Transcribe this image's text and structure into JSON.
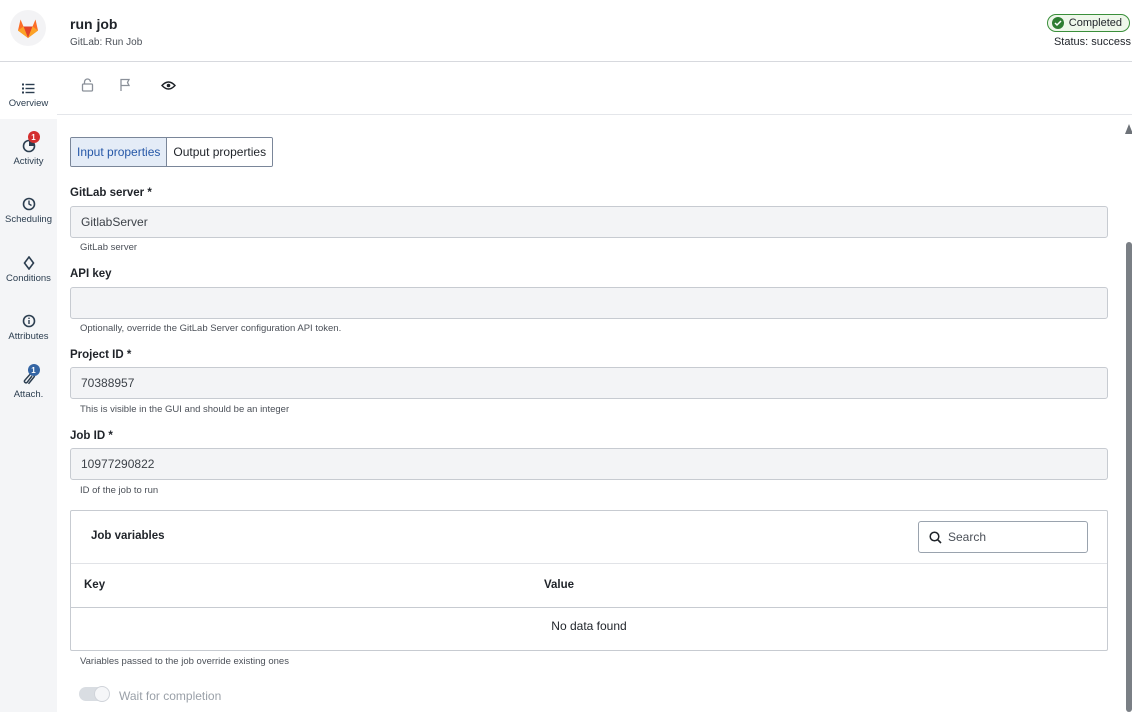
{
  "header": {
    "title": "run job",
    "subtitle": "GitLab: Run Job",
    "status_badge": "Completed",
    "status_text": "Status: success"
  },
  "rail": {
    "items": [
      {
        "label": "Overview",
        "icon": "list-icon"
      },
      {
        "label": "Activity",
        "icon": "activity-icon",
        "badge": "1"
      },
      {
        "label": "Scheduling",
        "icon": "clock-icon"
      },
      {
        "label": "Conditions",
        "icon": "diamond-icon"
      },
      {
        "label": "Attributes",
        "icon": "info-icon"
      },
      {
        "label": "Attach.",
        "icon": "paperclip-icon",
        "badge": "1"
      }
    ]
  },
  "toolbar": {
    "icons": [
      "lock-icon",
      "flag-icon",
      "eye-icon"
    ]
  },
  "tabs": {
    "input": "Input properties",
    "output": "Output properties"
  },
  "fields": {
    "server": {
      "label": "GitLab server *",
      "value": "GitlabServer",
      "help": "GitLab server"
    },
    "api_key": {
      "label": "API key",
      "value": "",
      "help": "Optionally, override the GitLab Server configuration API token."
    },
    "project_id": {
      "label": "Project ID *",
      "value": "70388957",
      "help": "This is visible in the GUI and should be an integer"
    },
    "job_id": {
      "label": "Job ID *",
      "value": "10977290822",
      "help": "ID of the job to run"
    }
  },
  "job_variables": {
    "title": "Job variables",
    "search_placeholder": "Search",
    "col_key": "Key",
    "col_value": "Value",
    "empty_text": "No data found",
    "help": "Variables passed to the job override existing ones"
  },
  "wait": {
    "label": "Wait for completion"
  },
  "colors": {
    "accent": "#2557a7",
    "success": "#2e7d32",
    "badge_red": "#d32f2f"
  }
}
